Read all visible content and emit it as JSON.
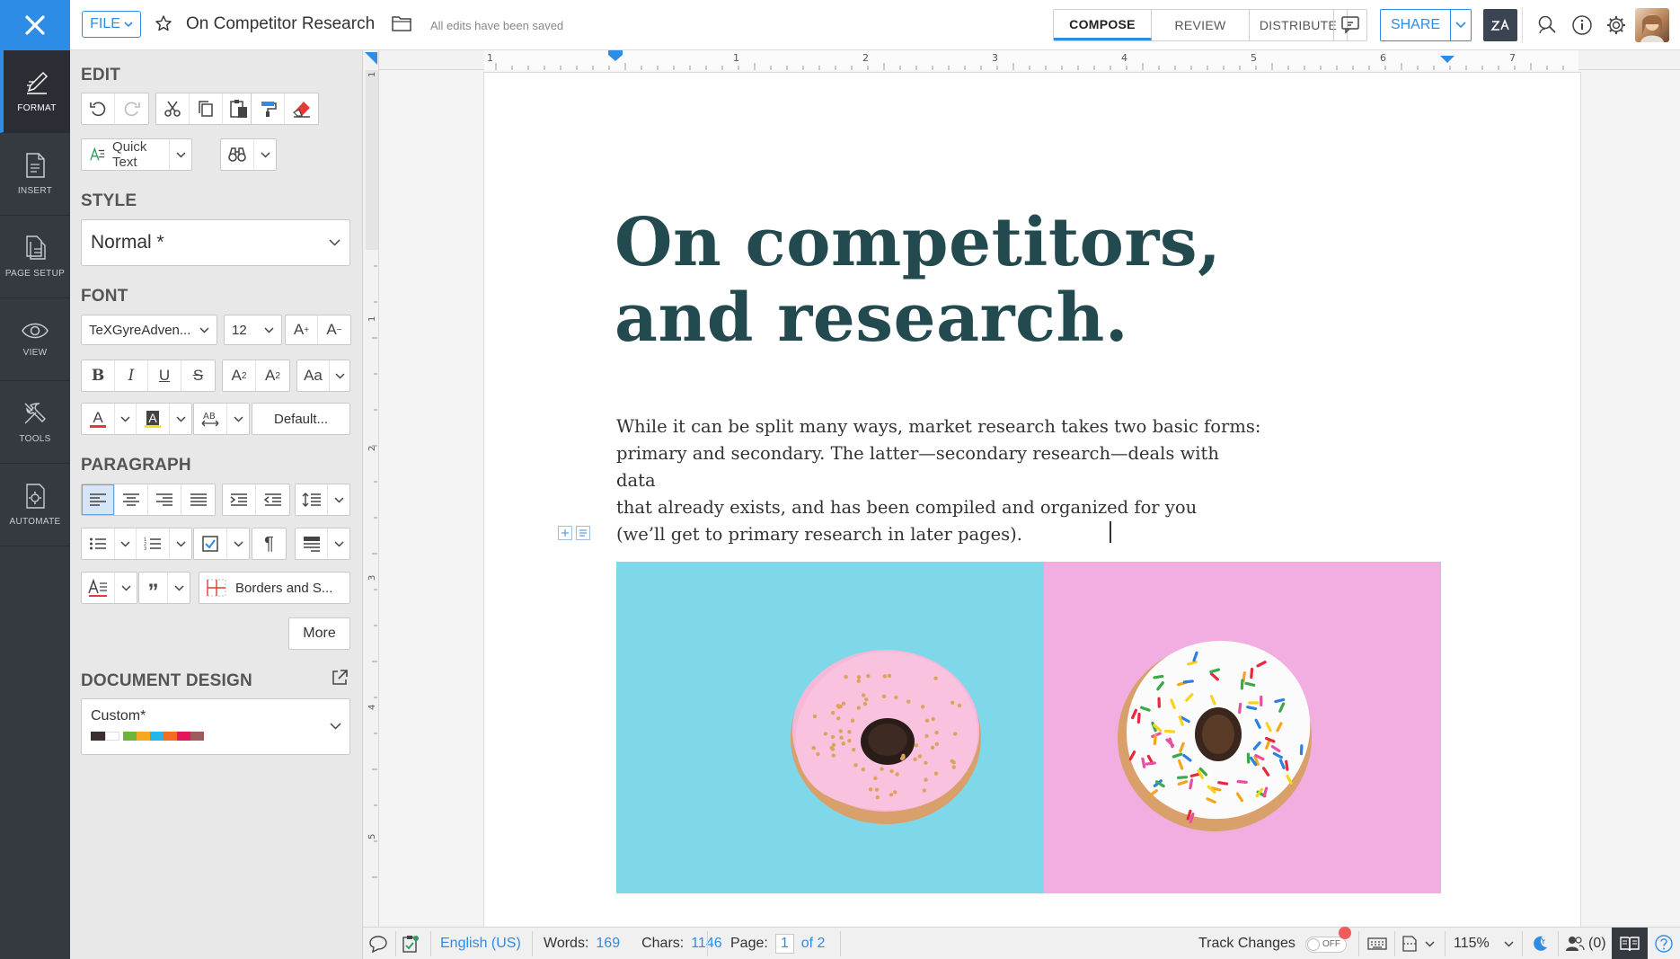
{
  "app": {
    "doc_title": "On Competitor Research",
    "save_status": "All edits have been saved",
    "file_label": "FILE",
    "modes": [
      "COMPOSE",
      "REVIEW",
      "DISTRIBUTE"
    ],
    "active_mode": "COMPOSE",
    "share_label": "SHARE",
    "accent": "#2d8ce6"
  },
  "rail": {
    "items": [
      {
        "label": "FORMAT",
        "icon": "pen-format-icon"
      },
      {
        "label": "INSERT",
        "icon": "insert-doc-icon"
      },
      {
        "label": "PAGE SETUP",
        "icon": "page-setup-icon"
      },
      {
        "label": "VIEW",
        "icon": "eye-icon"
      },
      {
        "label": "TOOLS",
        "icon": "tools-icon"
      },
      {
        "label": "AUTOMATE",
        "icon": "automate-gear-icon"
      }
    ],
    "active": "FORMAT"
  },
  "panel": {
    "edit_title": "EDIT",
    "quick_text": "Quick Text",
    "style_title": "STYLE",
    "style_value": "Normal *",
    "font_title": "FONT",
    "font_family": "TeXGyreAdven...",
    "font_size": "12",
    "default_btn": "Default...",
    "paragraph_title": "PARAGRAPH",
    "borders_btn": "Borders and S...",
    "more_btn": "More",
    "design_title": "DOCUMENT DESIGN",
    "design_value": "Custom*",
    "design_swatches": [
      "#3a2e2e",
      "#ffffff",
      "#6cb33f",
      "#f7a823",
      "#25b5e8",
      "#f26c22",
      "#e2165a",
      "#9c5a5a"
    ]
  },
  "document": {
    "heading_line1": "On competitors,",
    "heading_line2": "and research.",
    "para_line1": "While it can be split many ways, market research takes two basic forms:",
    "para_line2": "primary and secondary. The latter—secondary research—deals with data",
    "para_line3": "that already exists, and has been compiled and organized for you",
    "para_line4": "(we’ll get to primary research in later pages).",
    "heading_color": "#234a4e",
    "photo_left_bg": "#7fd8ea",
    "photo_right_bg": "#f2aee0"
  },
  "ruler": {
    "h_labels": [
      "1",
      "1",
      "2",
      "3",
      "4",
      "5",
      "6",
      "7"
    ],
    "v_labels": [
      "1",
      "1",
      "2",
      "3",
      "4",
      "5"
    ]
  },
  "status": {
    "language": "English (US)",
    "words_label": "Words:",
    "words": "169",
    "chars_label": "Chars:",
    "chars": "1146",
    "page_label": "Page:",
    "page": "1",
    "page_of": "of 2",
    "track_changes": "Track Changes",
    "track_state": "OFF",
    "zoom": "115%",
    "collab": "(0)"
  }
}
